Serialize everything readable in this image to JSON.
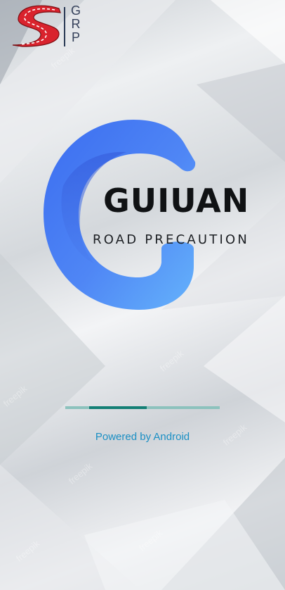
{
  "corner_logo": {
    "monogram": "GRP"
  },
  "main_logo": {
    "title": "GUIUAN",
    "subtitle": "ROAD PRECAUTION"
  },
  "loading": {
    "progress_bar_state": "indeterminate",
    "track_color": "#8cc2bd",
    "fill_color": "#137f75"
  },
  "footer": {
    "powered_by": "Powered by Android"
  },
  "background": {
    "watermarks": [
      "freepik",
      "freepik",
      "freepik",
      "freepik",
      "freepik",
      "freepik",
      "freepik"
    ]
  },
  "colors": {
    "logo_blue": "#4a7ff0",
    "logo_red": "#d9232d",
    "link_blue": "#1a8fc4"
  }
}
